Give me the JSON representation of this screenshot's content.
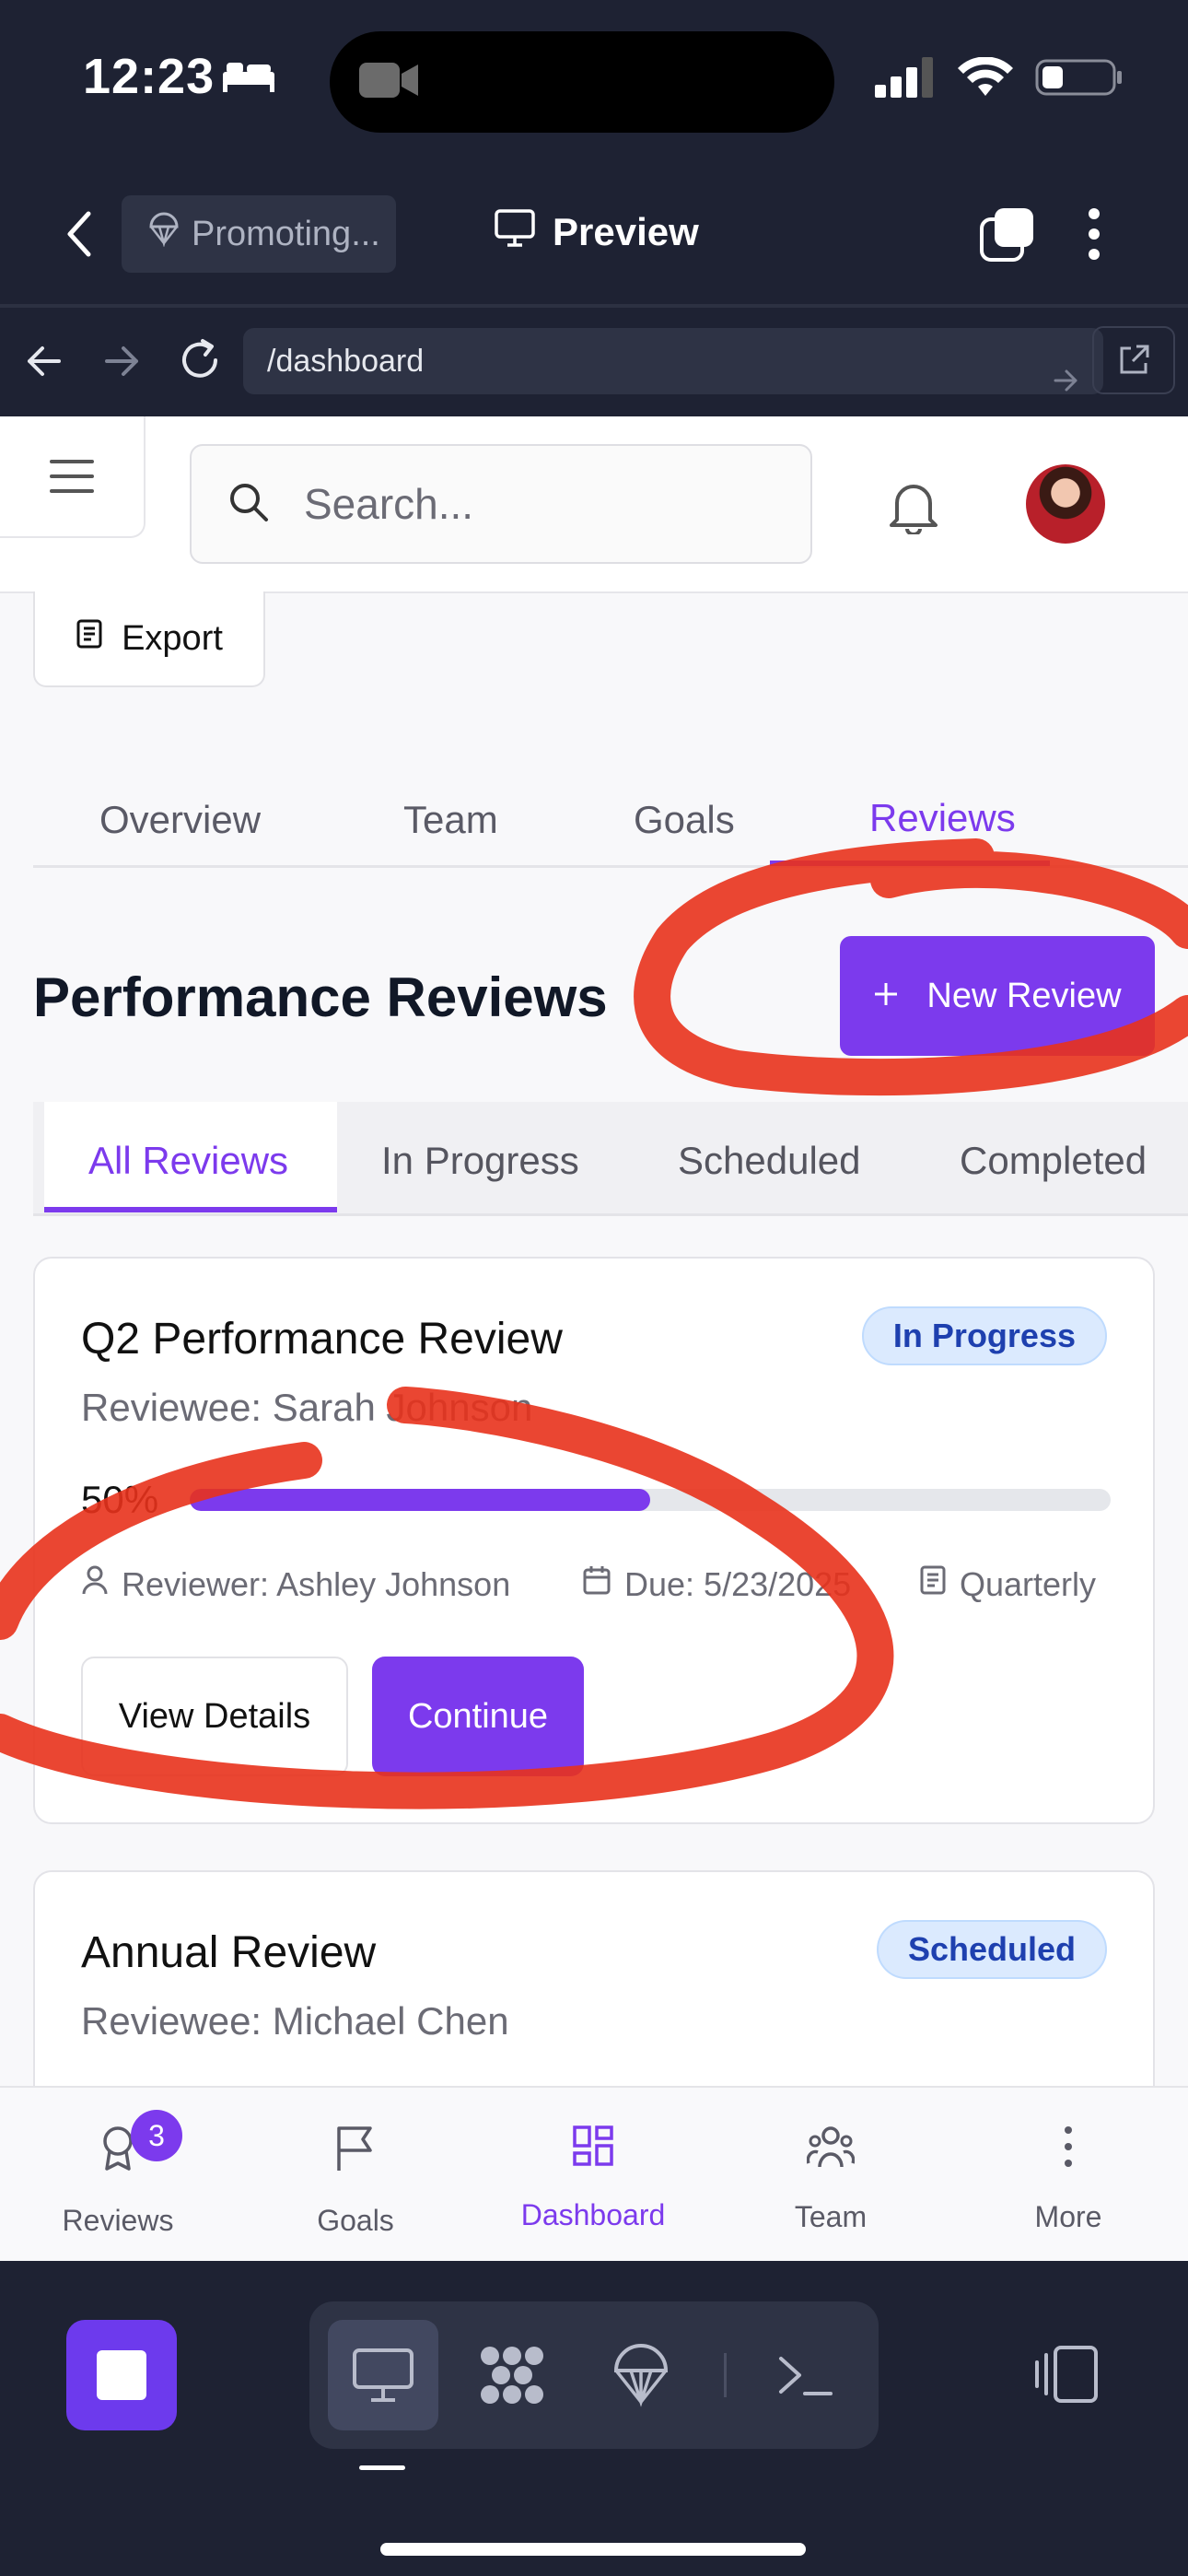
{
  "status_bar": {
    "time": "12:23"
  },
  "browser": {
    "project_name": "Promoting...",
    "preview_label": "Preview",
    "url": "/dashboard"
  },
  "topbar": {
    "search_placeholder": "Search..."
  },
  "export_label": "Export",
  "section_tabs": [
    "Overview",
    "Team",
    "Goals",
    "Reviews"
  ],
  "page": {
    "heading": "Performance Reviews",
    "new_review_label": "New Review"
  },
  "filter_tabs": [
    "All Reviews",
    "In Progress",
    "Scheduled",
    "Completed"
  ],
  "reviews": [
    {
      "title": "Q2 Performance Review",
      "reviewee": "Reviewee: Sarah Johnson",
      "status": "In Progress",
      "progress_text": "50%",
      "progress": 0.5,
      "reviewer": "Reviewer: Ashley Johnson",
      "due": "Due: 5/23/2025",
      "cycle": "Quarterly",
      "details_label": "View Details",
      "continue_label": "Continue"
    },
    {
      "title": "Annual Review",
      "reviewee": "Reviewee: Michael Chen",
      "status": "Scheduled"
    }
  ],
  "bottom_nav": [
    {
      "label": "Reviews",
      "icon": "award-icon",
      "badge": "3"
    },
    {
      "label": "Goals",
      "icon": "flag-icon"
    },
    {
      "label": "Dashboard",
      "icon": "dashboard-icon",
      "active": true
    },
    {
      "label": "Team",
      "icon": "users-icon"
    },
    {
      "label": "More",
      "icon": "more-vertical-icon"
    }
  ],
  "colors": {
    "accent": "#7c3aed",
    "annotation": "#e8321c",
    "chrome": "#1e2233"
  }
}
